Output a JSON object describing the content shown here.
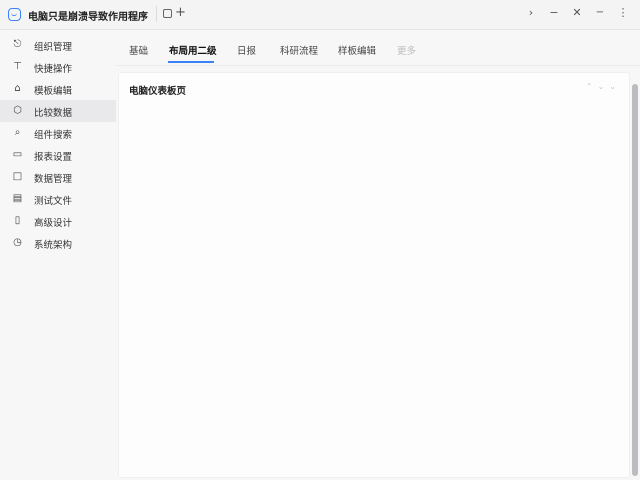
{
  "window": {
    "title": "电脑只是崩溃导致作用程序"
  },
  "sidebar": {
    "items": [
      {
        "label": "组织管理",
        "icon": "brain-icon"
      },
      {
        "label": "快捷操作",
        "icon": "pin-icon"
      },
      {
        "label": "模板编辑",
        "icon": "grad-cap-icon"
      },
      {
        "label": "比较数据",
        "icon": "cube-icon"
      },
      {
        "label": "组件搜索",
        "icon": "search-doc-icon"
      },
      {
        "label": "报表设置",
        "icon": "image-icon"
      },
      {
        "label": "数据管理",
        "icon": "box-icon"
      },
      {
        "label": "测试文件",
        "icon": "file-icon"
      },
      {
        "label": "高级设计",
        "icon": "tablet-icon"
      },
      {
        "label": "系统架构",
        "icon": "clock-icon"
      }
    ],
    "active_index": 3
  },
  "tabs": [
    {
      "label": "基础"
    },
    {
      "label": "布局用二级"
    },
    {
      "label": "日报"
    },
    {
      "label": "科研流程"
    },
    {
      "label": "样板编辑"
    },
    {
      "label": "更多"
    }
  ],
  "panel": {
    "title": "电脑仪表板页"
  }
}
